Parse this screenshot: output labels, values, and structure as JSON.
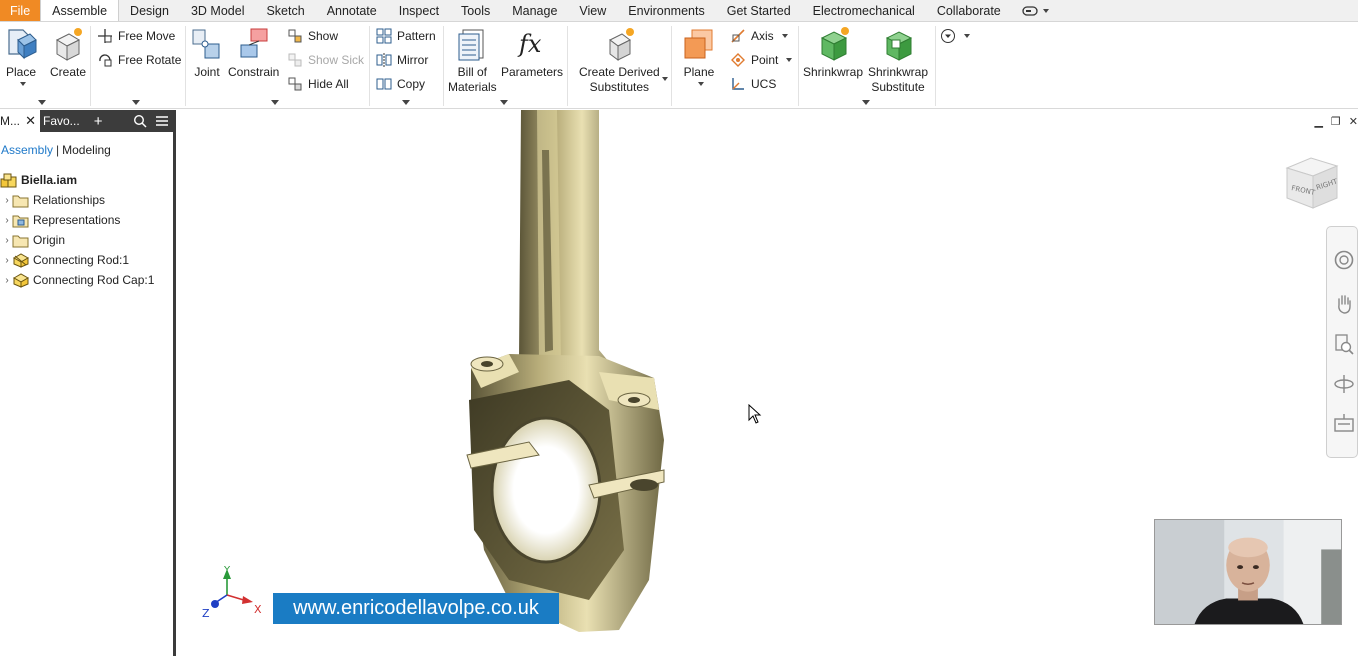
{
  "menubar": {
    "tabs": [
      {
        "label": "File"
      },
      {
        "label": "Assemble"
      },
      {
        "label": "Design"
      },
      {
        "label": "3D Model"
      },
      {
        "label": "Sketch"
      },
      {
        "label": "Annotate"
      },
      {
        "label": "Inspect"
      },
      {
        "label": "Tools"
      },
      {
        "label": "Manage"
      },
      {
        "label": "View"
      },
      {
        "label": "Environments"
      },
      {
        "label": "Get Started"
      },
      {
        "label": "Electromechanical"
      },
      {
        "label": "Collaborate"
      }
    ],
    "active_tab": "Assemble"
  },
  "ribbon": {
    "place": "Place",
    "create": "Create",
    "free_move": "Free Move",
    "free_rotate": "Free Rotate",
    "joint": "Joint",
    "constrain": "Constrain",
    "show": "Show",
    "show_sick": "Show Sick",
    "hide_all": "Hide All",
    "pattern": "Pattern",
    "mirror": "Mirror",
    "copy": "Copy",
    "bom_line1": "Bill of",
    "bom_line2": "Materials",
    "parameters": "Parameters",
    "derived_line1": "Create Derived",
    "derived_line2": "Substitutes",
    "plane": "Plane",
    "axis": "Axis",
    "point": "Point",
    "ucs": "UCS",
    "shrinkwrap": "Shrinkwrap",
    "shrinkwrap_sub_line1": "Shrinkwrap",
    "shrinkwrap_sub_line2": "Substitute"
  },
  "browser": {
    "model_tab": "M...",
    "fav_tab": "Favo...",
    "mode_assembly": "Assembly",
    "mode_modeling": "Modeling",
    "root": "Biella.iam",
    "items": [
      {
        "label": "Relationships",
        "icon": "folder-icon"
      },
      {
        "label": "Representations",
        "icon": "representations-icon"
      },
      {
        "label": "Origin",
        "icon": "folder-icon"
      },
      {
        "label": "Connecting Rod:1",
        "icon": "part-icon"
      },
      {
        "label": "Connecting Rod Cap:1",
        "icon": "part-icon"
      }
    ]
  },
  "viewport": {
    "viewcube_front": "FRONT",
    "viewcube_right": "RIGHT",
    "axis_x": "X",
    "axis_y": "Y",
    "axis_z": "Z",
    "watermark": "www.enricodellavolpe.co.uk"
  }
}
